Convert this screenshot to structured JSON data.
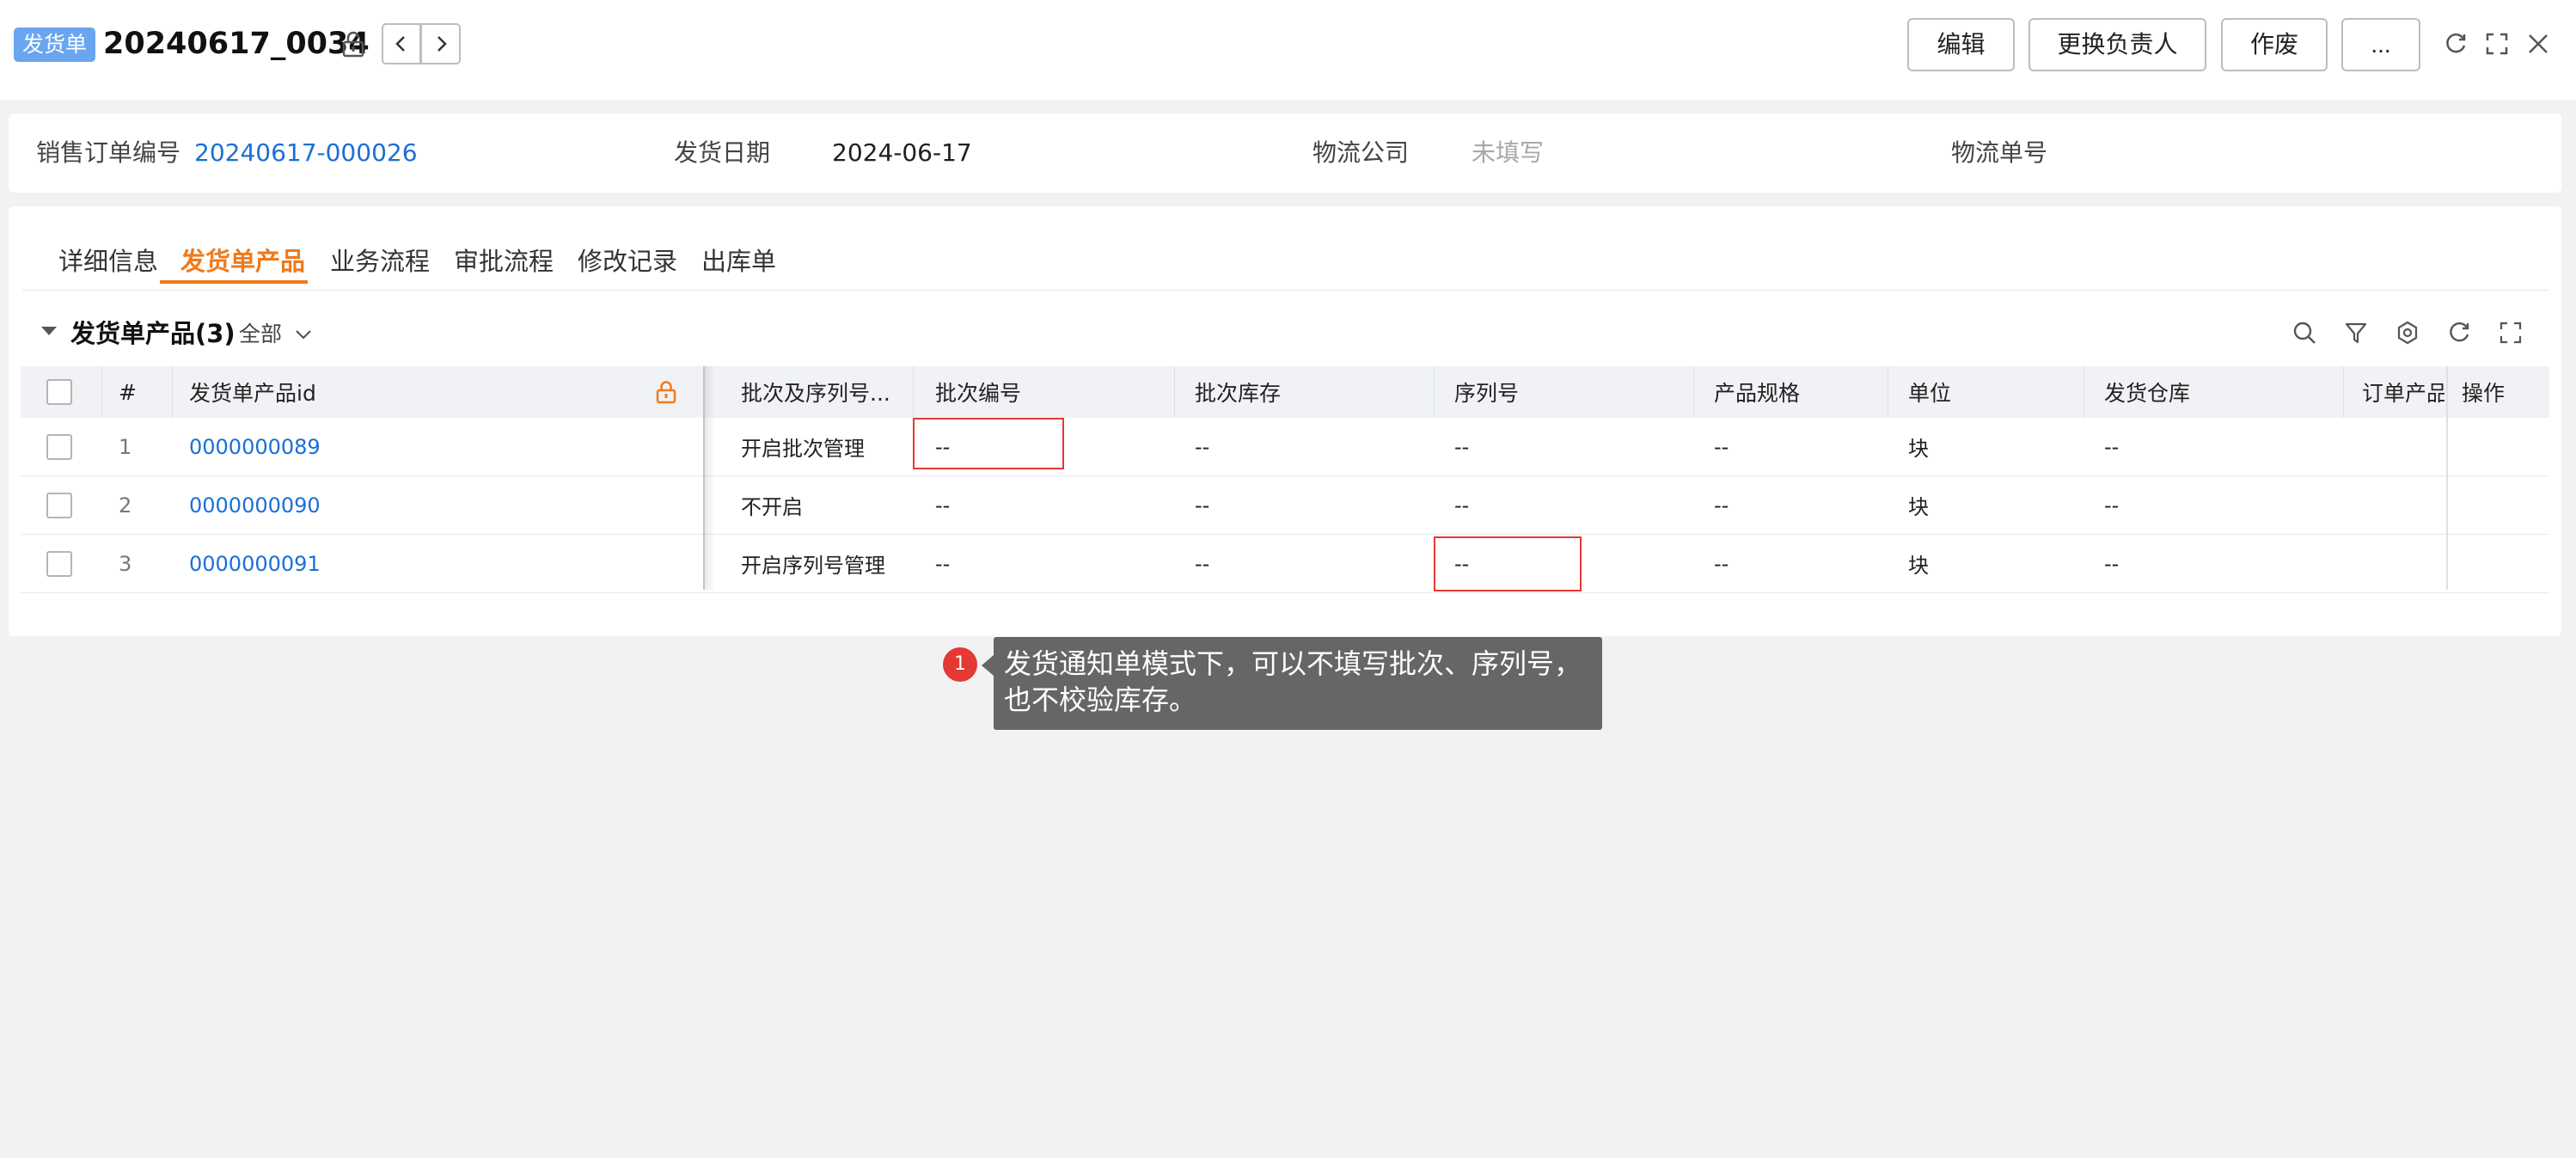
{
  "header": {
    "badge": "发货单",
    "title": "20240617_0034",
    "buttons": {
      "edit": "编辑",
      "change_owner": "更换负责人",
      "void": "作废",
      "more": "..."
    }
  },
  "info": {
    "sales_order_label": "销售订单编号",
    "sales_order_value": "20240617-000026",
    "ship_date_label": "发货日期",
    "ship_date_value": "2024-06-17",
    "logistics_company_label": "物流公司",
    "logistics_company_value": "未填写",
    "tracking_no_label": "物流单号"
  },
  "tabs": [
    "详细信息",
    "发货单产品",
    "业务流程",
    "审批流程",
    "修改记录",
    "出库单"
  ],
  "section": {
    "title": "发货单产品(3)",
    "filter": "全部"
  },
  "table": {
    "columns": {
      "index": "#",
      "product_id": "发货单产品id",
      "batch_serial": "批次及序列号...",
      "batch_no": "批次编号",
      "batch_stock": "批次库存",
      "serial_no": "序列号",
      "spec": "产品规格",
      "unit": "单位",
      "warehouse": "发货仓库",
      "order_product": "订单产品",
      "ops": "操作"
    },
    "rows": [
      {
        "index": "1",
        "product_id": "0000000089",
        "batch_serial": "开启批次管理",
        "batch_no": "--",
        "batch_stock": "--",
        "serial_no": "--",
        "spec": "--",
        "unit": "块",
        "warehouse": "--"
      },
      {
        "index": "2",
        "product_id": "0000000090",
        "batch_serial": "不开启",
        "batch_no": "--",
        "batch_stock": "--",
        "serial_no": "--",
        "spec": "--",
        "unit": "块",
        "warehouse": "--"
      },
      {
        "index": "3",
        "product_id": "0000000091",
        "batch_serial": "开启序列号管理",
        "batch_no": "--",
        "batch_stock": "--",
        "serial_no": "--",
        "spec": "--",
        "unit": "块",
        "warehouse": "--"
      }
    ]
  },
  "annotation": {
    "number": "1",
    "line1": "发货通知单模式下，可以不填写批次、序列号，",
    "line2": "也不校验库存。"
  },
  "colors": {
    "accent": "#f07a1a",
    "link": "#1a6fd6",
    "badge": "#6aa5f0",
    "highlight": "#e53935"
  }
}
